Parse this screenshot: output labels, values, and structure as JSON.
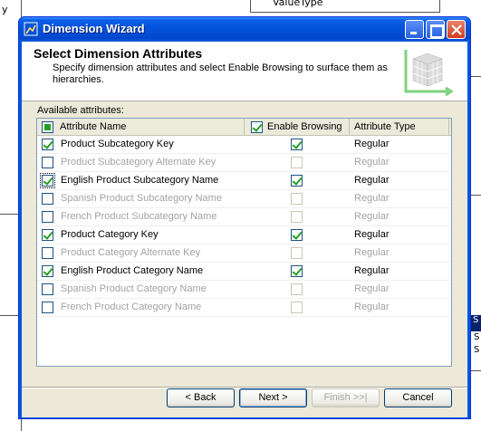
{
  "background": {
    "left_text": "y",
    "top_box_label": "ValueType",
    "right_header": "S",
    "right_rows": [
      "S",
      "S"
    ]
  },
  "window": {
    "title": "Dimension Wizard",
    "icon": "wizard-icon"
  },
  "header": {
    "title": "Select Dimension Attributes",
    "description": "Specify dimension attributes and select Enable Browsing to surface them as hierarchies.",
    "graphic": "dimension-cube-graphic"
  },
  "content": {
    "available_label": "Available attributes:",
    "columns": {
      "name": "Attribute Name",
      "enable_browsing": "Enable Browsing",
      "type": "Attribute Type"
    },
    "rows": [
      {
        "name": "Product Subcategory Key",
        "selected": true,
        "browsing": true,
        "type": "Regular"
      },
      {
        "name": "Product Subcategory Alternate Key",
        "selected": false,
        "browsing": false,
        "type": "Regular"
      },
      {
        "name": "English Product Subcategory Name",
        "selected": true,
        "browsing": true,
        "type": "Regular"
      },
      {
        "name": "Spanish Product Subcategory Name",
        "selected": false,
        "browsing": false,
        "type": "Regular"
      },
      {
        "name": "French Product Subcategory Name",
        "selected": false,
        "browsing": false,
        "type": "Regular"
      },
      {
        "name": "Product Category Key",
        "selected": true,
        "browsing": true,
        "type": "Regular"
      },
      {
        "name": "Product Category Alternate Key",
        "selected": false,
        "browsing": false,
        "type": "Regular"
      },
      {
        "name": "English Product Category Name",
        "selected": true,
        "browsing": true,
        "type": "Regular"
      },
      {
        "name": "Spanish Product Category Name",
        "selected": false,
        "browsing": false,
        "type": "Regular"
      },
      {
        "name": "French Product Category Name",
        "selected": false,
        "browsing": false,
        "type": "Regular"
      }
    ]
  },
  "buttons": {
    "back": "< Back",
    "next": "Next >",
    "finish": "Finish >>|",
    "cancel": "Cancel"
  },
  "colors": {
    "title_bar": "#0550d8",
    "check": "#21a121",
    "disabled_text": "#a3a3a3"
  }
}
